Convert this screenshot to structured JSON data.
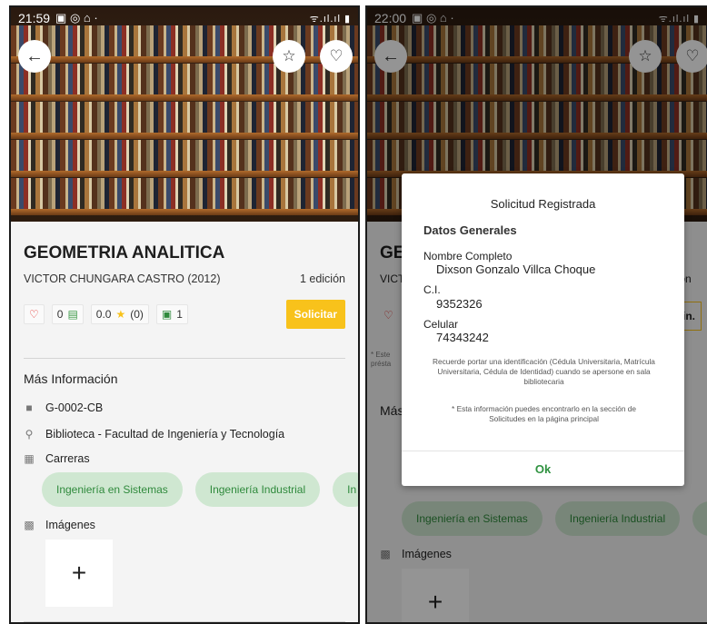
{
  "left_screen": {
    "status_time": "21:59",
    "status_icons": "▣ ◎ ⌂ ·",
    "status_right": "ᯤ.ıl.ıl ▮",
    "title": "GEOMETRIA ANALITICA",
    "author": "VICTOR CHUNGARA CASTRO (2012)",
    "edition": "1 edición",
    "stats": {
      "comments": "0",
      "rating": "0.0",
      "rating_count": "(0)",
      "copies": "1"
    },
    "solicitar_label": "Solicitar",
    "more_info_title": "Más Información",
    "code": "G-0002-CB",
    "location": "Biblioteca - Facultad de Ingeniería y Tecnología",
    "carreras_label": "Carreras",
    "chips": [
      "Ingeniería en Sistemas",
      "Ingeniería Industrial",
      "In"
    ],
    "imagenes_label": "Imágenes",
    "add_symbol": "+"
  },
  "right_screen": {
    "status_time": "22:00",
    "status_icons": "▣ ◎ ⌂ ·",
    "status_right": "ᯤ.ıl.ıl ▮",
    "partial_title": "GE",
    "partial_author": "VICT",
    "partial_edition": "ición",
    "partial_button": "in.",
    "partial_note": "* Este",
    "partial_note2": "présta",
    "partial_more": "Más",
    "chips": [
      "Ingeniería en Sistemas",
      "Ingeniería Industrial",
      "In"
    ],
    "imagenes_label": "Imágenes",
    "add_symbol": "+",
    "dialog": {
      "title": "Solicitud Registrada",
      "heading": "Datos Generales",
      "name_label": "Nombre Completo",
      "name_value": "Dixson Gonzalo Villca Choque",
      "ci_label": "C.I.",
      "ci_value": "9352326",
      "cel_label": "Celular",
      "cel_value": "74343242",
      "note1": "Recuerde portar una identificación (Cédula Universitaria, Matrícula Universitaria, Cédula de Identidad) cuando se apersone en sala bibliotecaria",
      "note2": "* Esta información puedes encontrarlo en la sección de Solicitudes en la página principal",
      "ok_label": "Ok"
    }
  },
  "colors": {
    "accent_yellow": "#f8c21b",
    "chip_bg": "#cfe7d1",
    "chip_text": "#2f8a3c",
    "ok_green": "#2f9240"
  }
}
